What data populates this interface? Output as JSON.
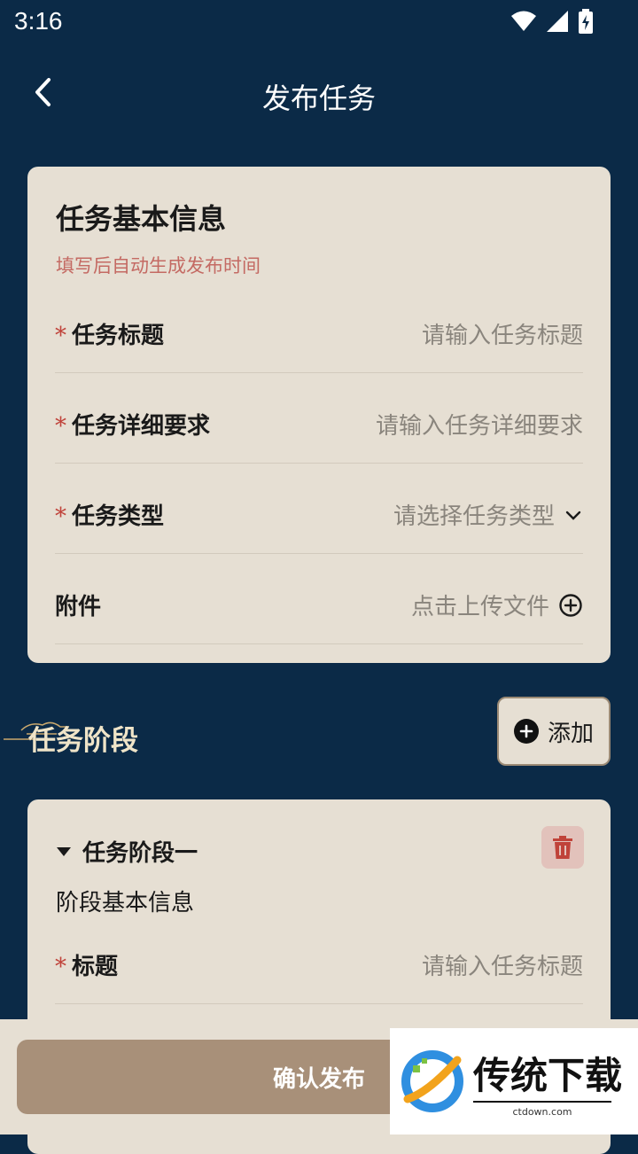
{
  "status_bar": {
    "time": "3:16"
  },
  "header": {
    "title": "发布任务"
  },
  "info_card": {
    "title": "任务基本信息",
    "subtitle": "填写后自动生成发布时间",
    "fields": [
      {
        "required": "*",
        "label": "任务标题",
        "placeholder": "请输入任务标题"
      },
      {
        "required": "*",
        "label": "任务详细要求",
        "placeholder": "请输入任务详细要求"
      },
      {
        "required": "*",
        "label": "任务类型",
        "placeholder": "请选择任务类型"
      },
      {
        "required": "",
        "label": "附件",
        "placeholder": "点击上传文件"
      }
    ]
  },
  "stages": {
    "title": "任务阶段",
    "add_label": "添加",
    "stage_name": "任务阶段一",
    "section_label": "阶段基本信息",
    "fields": [
      {
        "required": "*",
        "label": "标题",
        "placeholder": "请输入任务标题"
      }
    ]
  },
  "footer": {
    "confirm_label": "确认发布"
  },
  "watermark": {
    "brand": "传统下载",
    "url": "ctdown.com"
  },
  "colors": {
    "background": "#0b2a47",
    "card": "#e6dfd3",
    "accent": "#a89079",
    "required": "#c0433a",
    "hint": "#c46a63"
  }
}
